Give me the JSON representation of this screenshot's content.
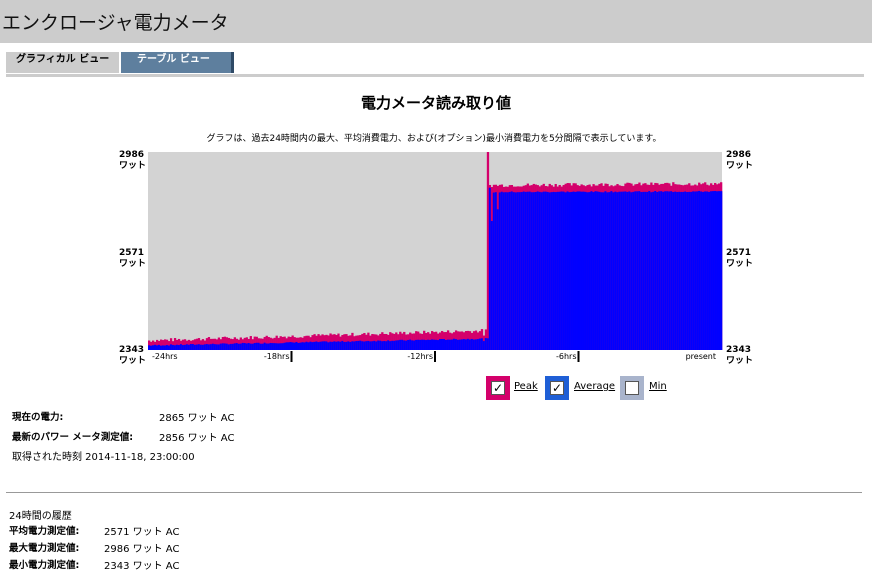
{
  "title": "エンクロージャ電力メータ",
  "tabs": [
    {
      "label": "グラフィカル ビュー",
      "active": true
    },
    {
      "label": "テーブル ビュー",
      "active": false
    }
  ],
  "heading": "電力メータ読み取り値",
  "subtitle": "グラフは、過去24時間内の最大、平均消費電力、および(オプション)最小消費電力を5分間隔で表示しています。",
  "chart_data": {
    "type": "bar",
    "y_ticks": [
      {
        "value": "2986",
        "unit": "ワット"
      },
      {
        "value": "2571",
        "unit": "ワット"
      },
      {
        "value": "2343",
        "unit": "ワット"
      }
    ],
    "ylim": [
      2343,
      2986
    ],
    "x_ticks": [
      "-24hrs",
      "-18hrs",
      "-12hrs",
      "-6hrs",
      "present"
    ],
    "series": [
      {
        "name": "Peak",
        "color": "#d4006b",
        "levels": [
          {
            "from_hrs": -24,
            "to_hrs": -9.8,
            "start": 2368,
            "end": 2400
          },
          {
            "from_hrs": -9.8,
            "to_hrs": 0,
            "start": 2872,
            "end": 2877
          }
        ]
      },
      {
        "name": "Average",
        "color": "#0000ff",
        "levels": [
          {
            "from_hrs": -24,
            "to_hrs": -9.8,
            "start": 2358,
            "end": 2380
          },
          {
            "from_hrs": -9.8,
            "to_hrs": 0,
            "start": 2856,
            "end": 2858
          }
        ]
      }
    ],
    "grid": false,
    "background": "#d3d3d3"
  },
  "legend": [
    {
      "label": "Peak",
      "checked": true,
      "color": "#d4006b"
    },
    {
      "label": "Average",
      "checked": true,
      "color": "#1f5fd6"
    },
    {
      "label": "Min",
      "checked": false,
      "color": "#a9b4cc"
    }
  ],
  "current": {
    "power_label": "現在の電力:",
    "power_value": "2865 ワット AC",
    "latest_label": "最新のパワー メータ測定値:",
    "latest_value": "2856 ワット AC",
    "time_text": "取得された時刻 2014-11-18, 23:00:00"
  },
  "history": {
    "title": "24時間の履歴",
    "avg_label": "平均電力測定値:",
    "avg_value": "2571 ワット AC",
    "max_label": "最大電力測定値:",
    "max_value": "2986 ワット AC",
    "min_label": "最小電力測定値:",
    "min_value": "2343 ワット AC"
  }
}
